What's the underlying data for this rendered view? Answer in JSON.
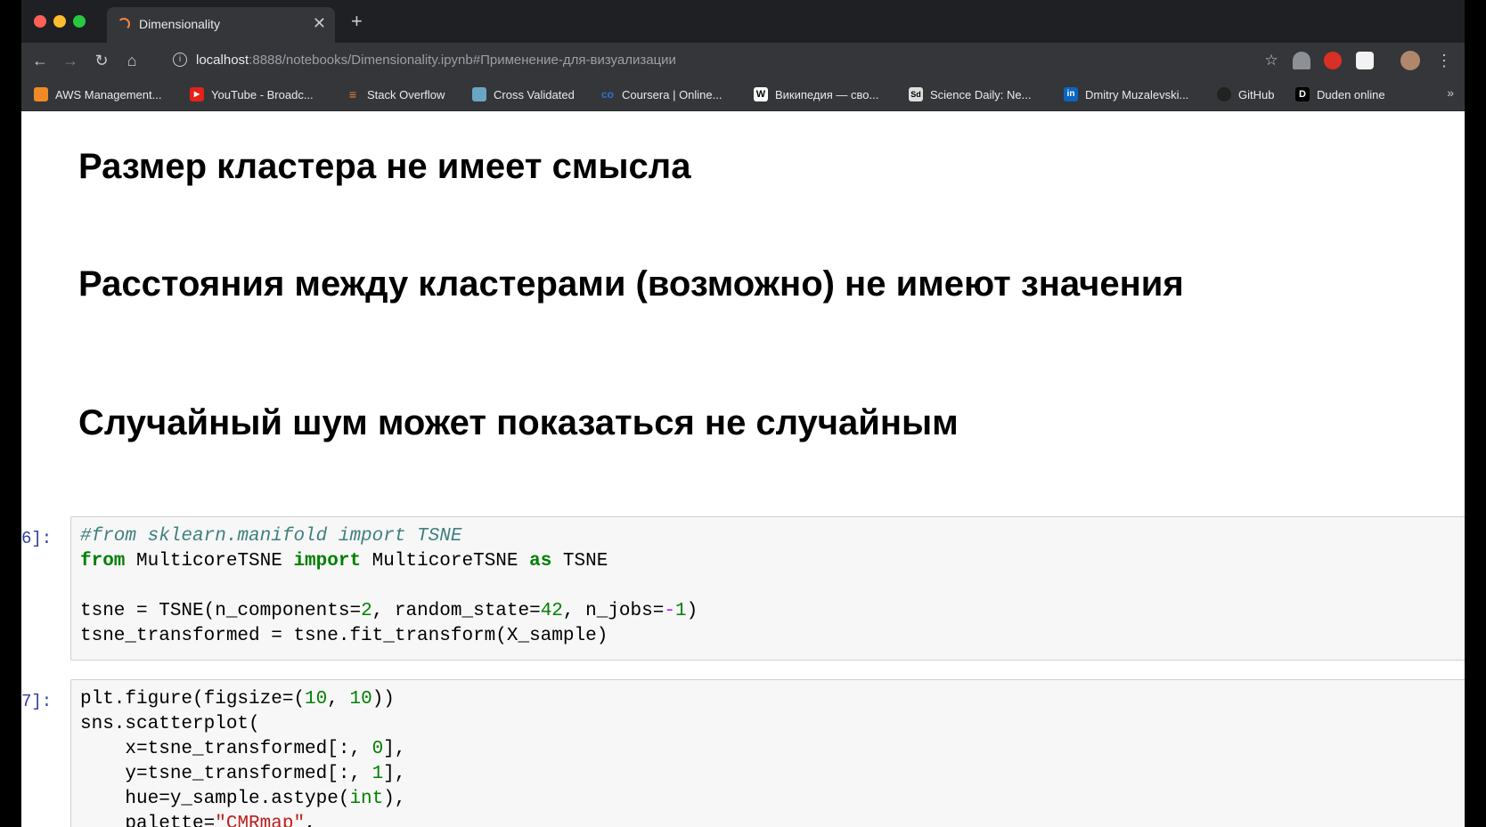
{
  "browser": {
    "tab_title": "Dimensionality",
    "url_host": "localhost",
    "url_rest": ":8888/notebooks/Dimensionality.ipynb#Применение-для-визуализации"
  },
  "bookmarks": [
    {
      "label": "AWS Management...",
      "icon": "aws-icon",
      "color": "#f08a24"
    },
    {
      "label": "YouTube - Broadc...",
      "icon": "youtube-icon",
      "color": "#e62117"
    },
    {
      "label": "Stack Overflow",
      "icon": "stackoverflow-icon",
      "color": "#f48024"
    },
    {
      "label": "Cross Validated",
      "icon": "crossvalidated-icon",
      "color": "#6aa6c4"
    },
    {
      "label": "Coursera | Online...",
      "icon": "coursera-icon",
      "color": "#2a73cc"
    },
    {
      "label": "Википедия — сво...",
      "icon": "wikipedia-icon",
      "color": "#ffffff"
    },
    {
      "label": "Science Daily: Ne...",
      "icon": "sciencedaily-icon",
      "color": "#dddddd"
    },
    {
      "label": "Dmitry Muzalevski...",
      "icon": "linkedin-icon",
      "color": "#0a66c2"
    },
    {
      "label": "GitHub",
      "icon": "github-icon",
      "color": "#222222"
    },
    {
      "label": "Duden online",
      "icon": "duden-icon",
      "color": "#000000"
    }
  ],
  "notebook": {
    "headings": [
      "Размер кластера не имеет смысла",
      "Расстояния между кластерами (возможно) не имеют значения",
      "Случайный шум может показаться не случайным"
    ],
    "cells": [
      {
        "prompt": "6]:"
      },
      {
        "prompt": "7]:"
      }
    ]
  }
}
